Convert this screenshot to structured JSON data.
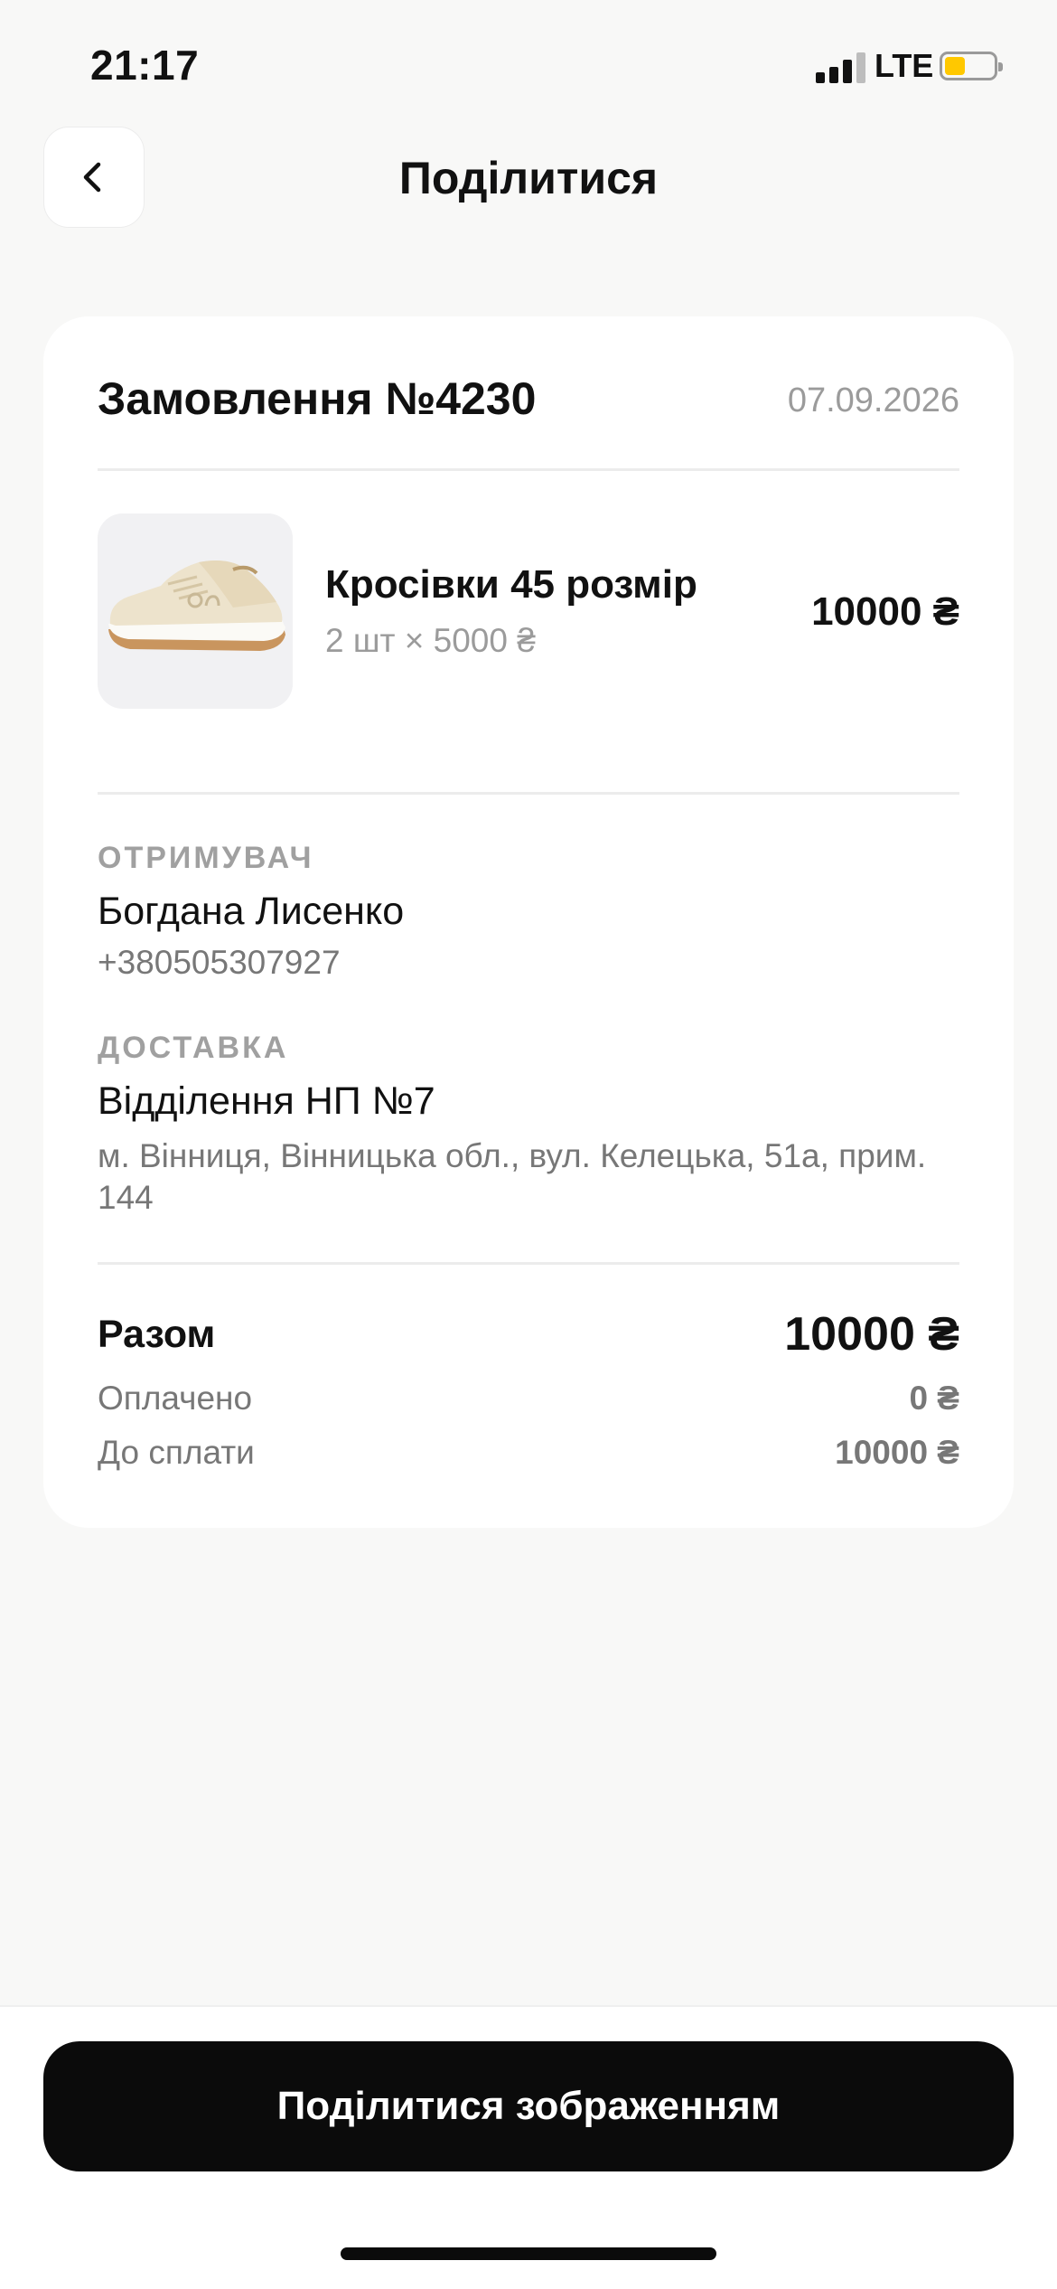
{
  "status_bar": {
    "time": "21:17",
    "network": "LTE",
    "signal_icon": "signal-bars-icon",
    "battery_icon": "battery-icon",
    "battery_color": "#ffc800"
  },
  "header": {
    "title": "Поділитися",
    "back_icon": "chevron-left-icon"
  },
  "order": {
    "title": "Замовлення №4230",
    "date": "07.09.2026",
    "item": {
      "image_icon": "sneaker-image",
      "name": "Кросівки 45 розмір",
      "quantity_line": "2 шт × 5000 ₴",
      "price": "10000 ₴"
    },
    "recipient": {
      "label": "ОТРИМУВАЧ",
      "name": "Богдана Лисенко",
      "phone": "+380505307927"
    },
    "delivery": {
      "label": "ДОСТАВКА",
      "branch": "Відділення НП №7",
      "address": "м. Вінниця, Вінницька обл., вул. Келецька, 51а, прим. 144"
    },
    "summary": {
      "total_label": "Разом",
      "total_value": "10000 ₴",
      "paid_label": "Оплачено",
      "paid_value": "0 ₴",
      "due_label": "До сплати",
      "due_value": "10000 ₴"
    }
  },
  "actions": {
    "share_label": "Поділитися зображенням"
  },
  "colors": {
    "background": "#f8f8f7",
    "card": "#ffffff",
    "button": "#0b0b0b",
    "muted_text": "#9b9b9b"
  }
}
